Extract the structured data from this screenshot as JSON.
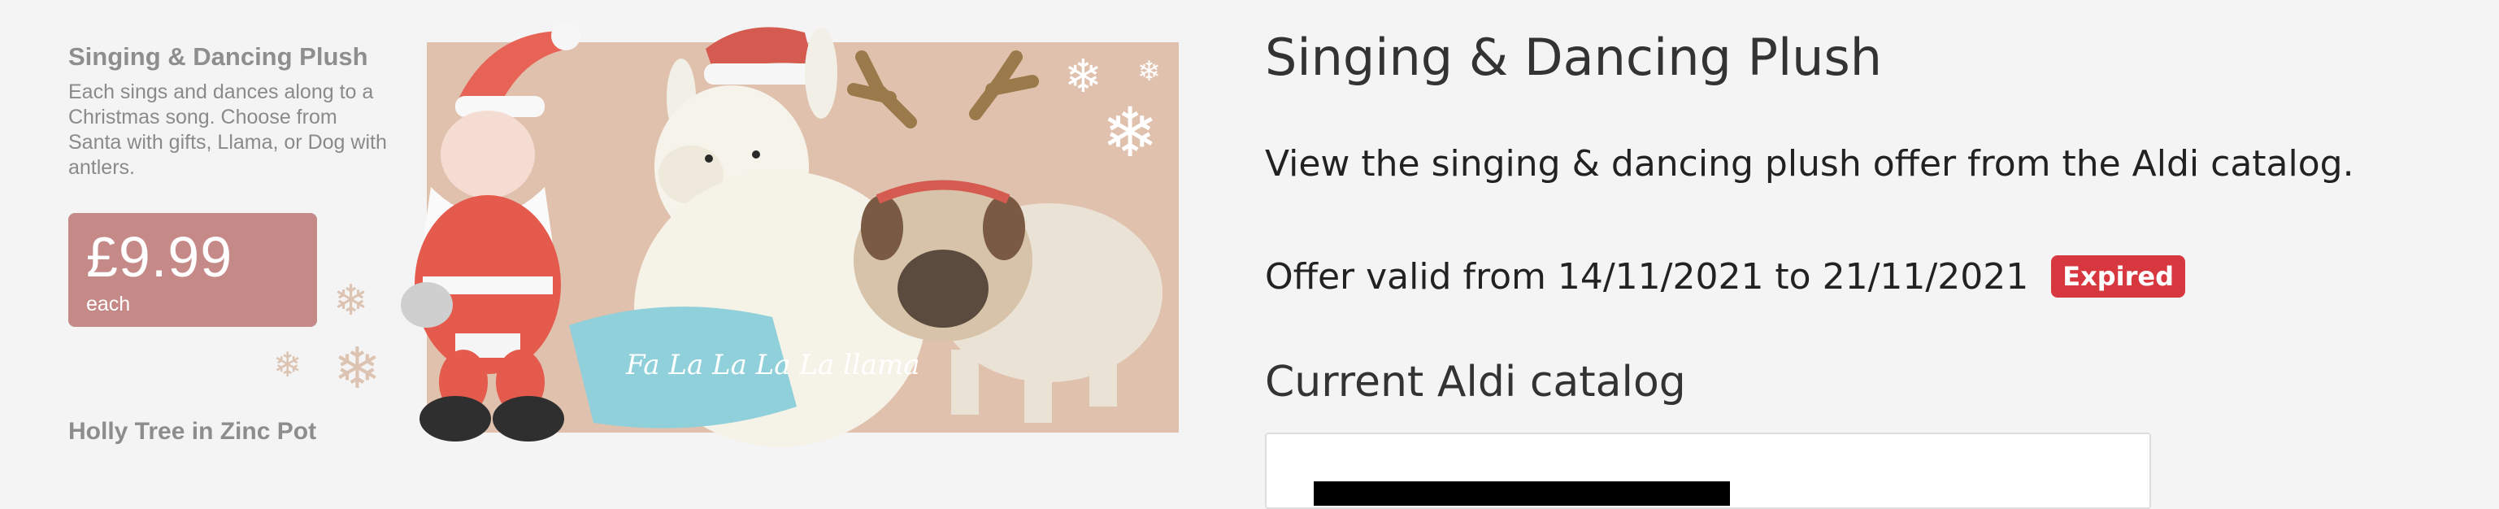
{
  "leaflet": {
    "title": "Singing & Dancing Plush",
    "description": "Each sings and dances along to a Christmas song. Choose from Santa with gifts, Llama, or Dog with antlers.",
    "price": "£9.99",
    "price_unit": "each",
    "next_title": "Holly Tree in Zinc Pot",
    "blanket_text": "Fa La La La La llama",
    "colors": {
      "price_box": "#c58a88",
      "photo_bg": "#e0c1ad"
    }
  },
  "offer": {
    "title": "Singing & Dancing Plush",
    "description": "View the singing & dancing plush offer from the Aldi catalog.",
    "validity": "Offer valid from 14/11/2021 to 21/11/2021",
    "status_badge": "Expired",
    "badge_color": "#d7373f"
  },
  "catalog_section": {
    "heading": "Current Aldi catalog"
  },
  "icons": [
    "snowflake-icon"
  ]
}
